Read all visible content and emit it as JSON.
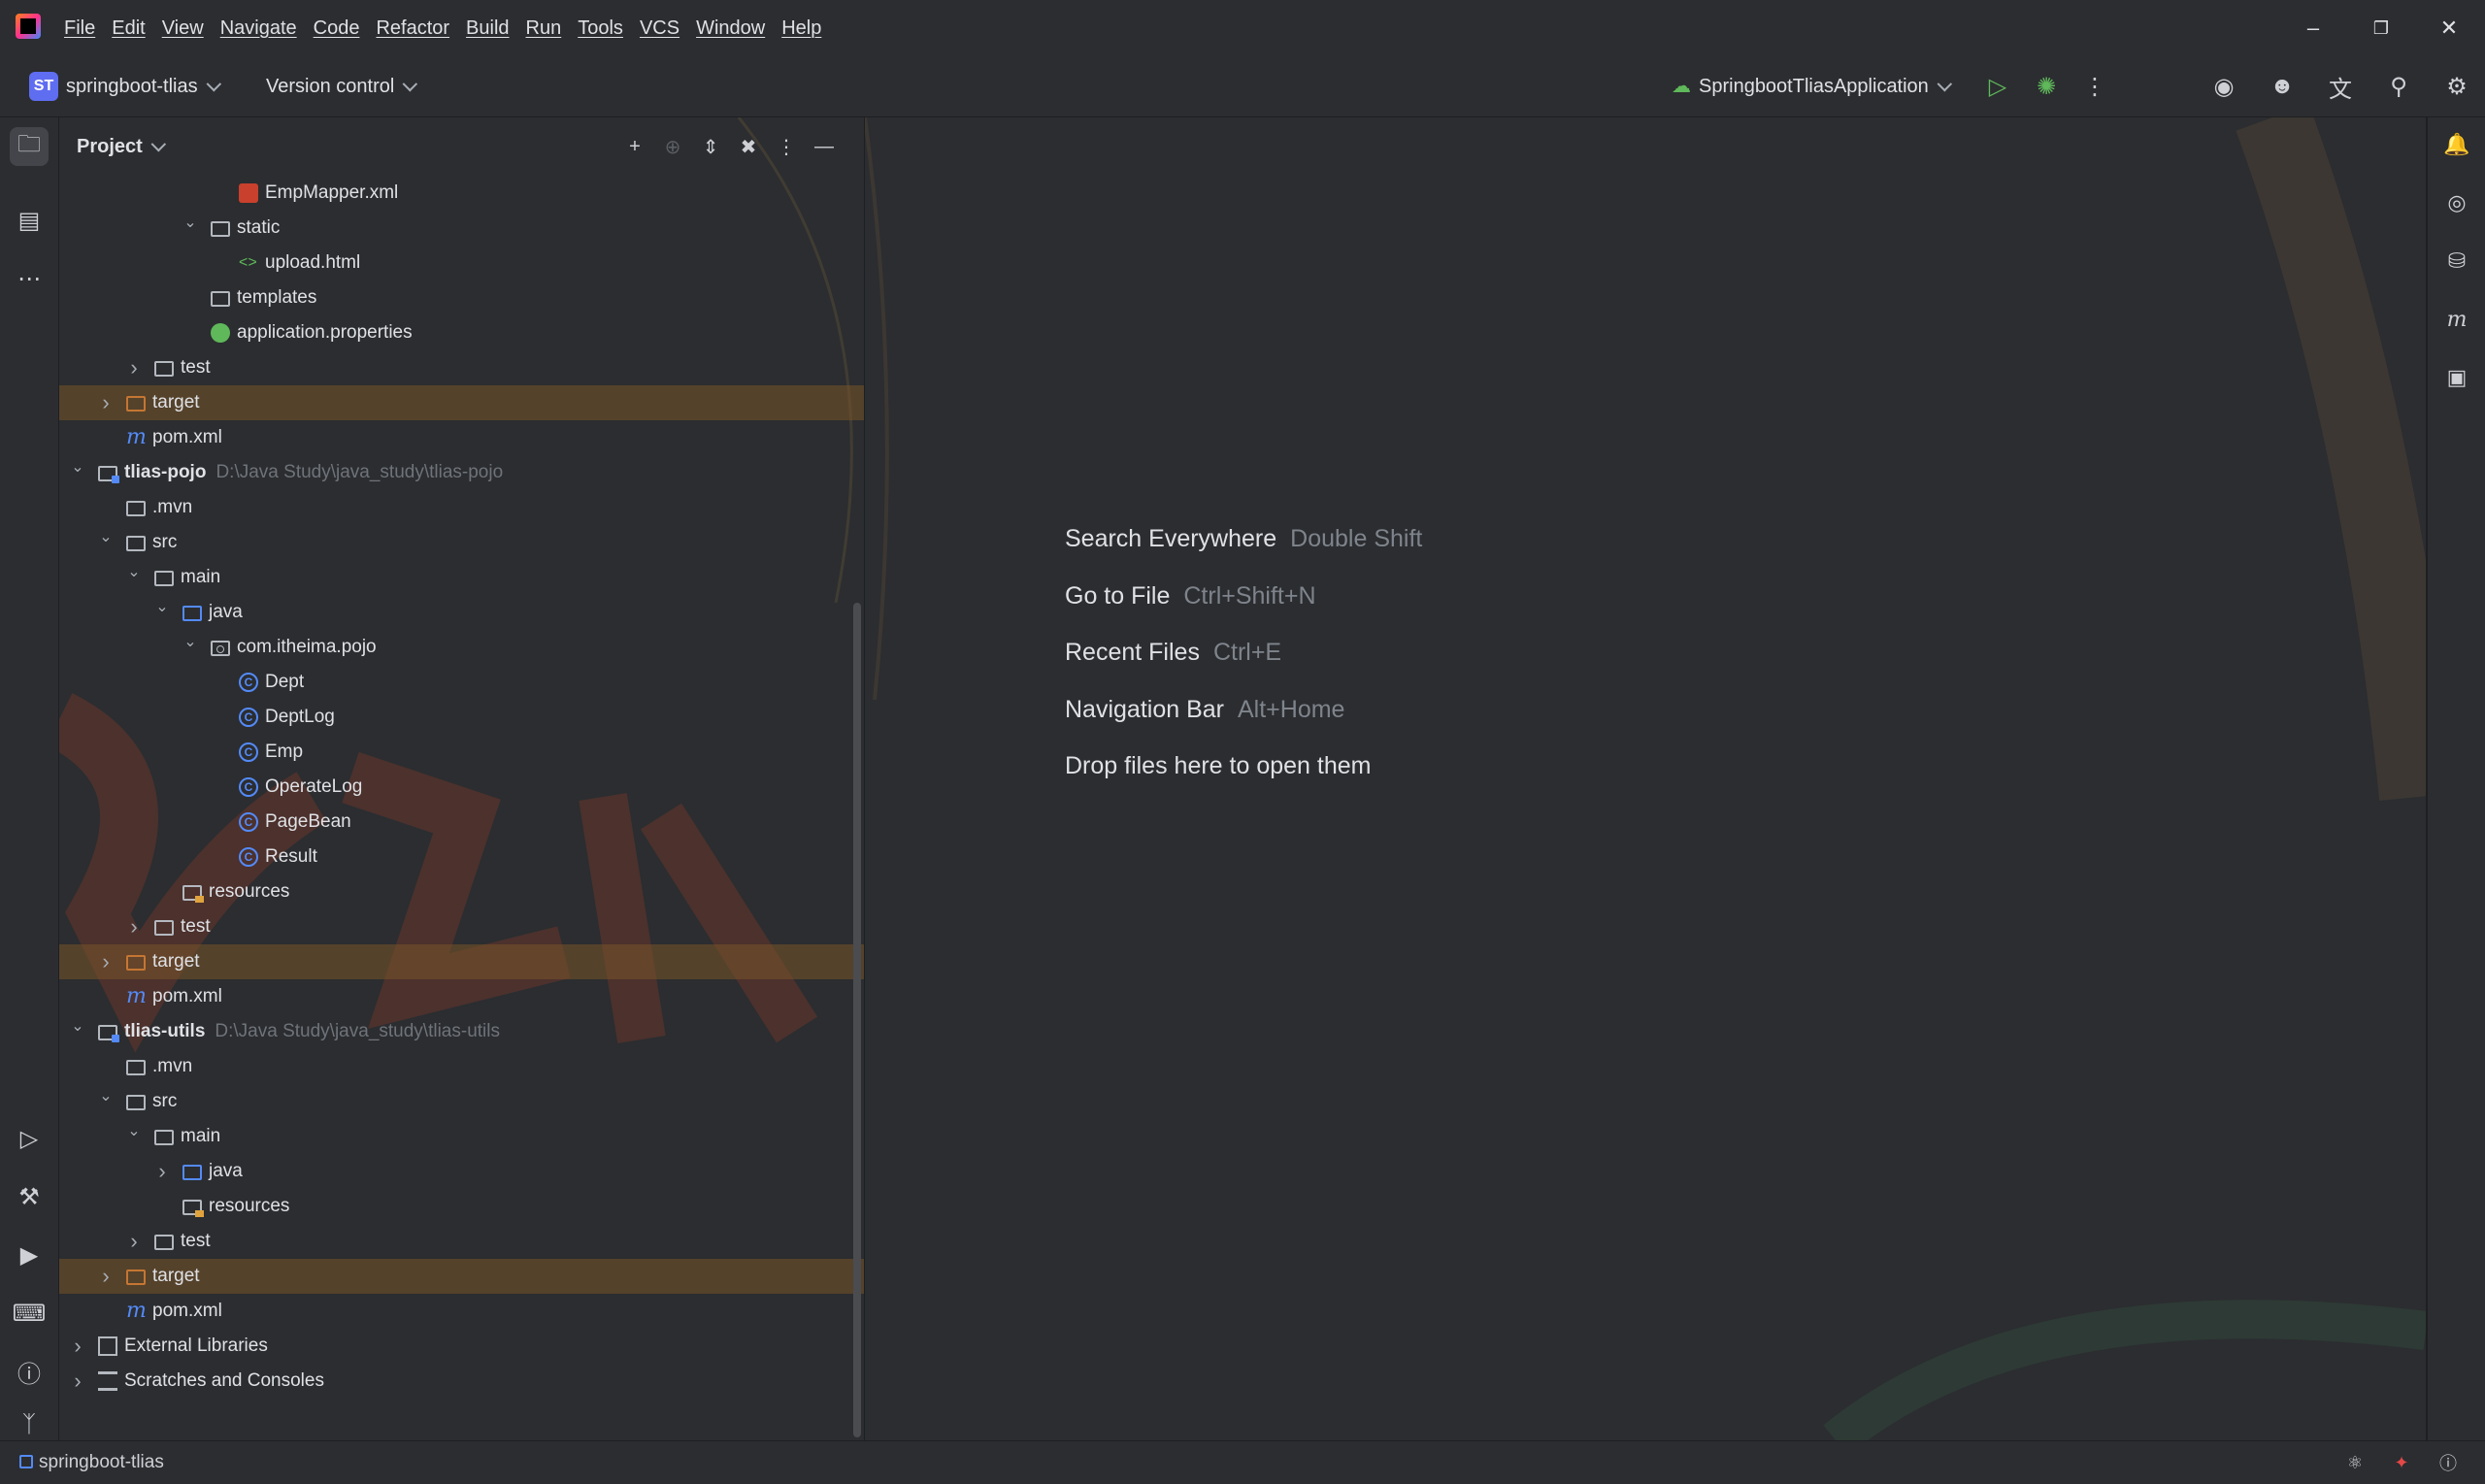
{
  "menu": [
    "File",
    "Edit",
    "View",
    "Navigate",
    "Code",
    "Refactor",
    "Build",
    "Run",
    "Tools",
    "VCS",
    "Window",
    "Help"
  ],
  "toolbar": {
    "project_badge": "ST",
    "project_name": "springboot-tlias",
    "version_control": "Version control",
    "run_config": "SpringbootTliasApplication"
  },
  "panel": {
    "title": "Project"
  },
  "tree": [
    {
      "depth": 6,
      "arrow": "",
      "icon": "xml",
      "label": "EmpMapper.xml",
      "hl": false
    },
    {
      "depth": 5,
      "arrow": "open",
      "icon": "folder",
      "label": "static",
      "hl": false
    },
    {
      "depth": 6,
      "arrow": "",
      "icon": "html",
      "label": "upload.html",
      "hl": false
    },
    {
      "depth": 5,
      "arrow": "",
      "icon": "folder",
      "label": "templates",
      "hl": false
    },
    {
      "depth": 5,
      "arrow": "",
      "icon": "props",
      "label": "application.properties",
      "hl": false
    },
    {
      "depth": 3,
      "arrow": "closed",
      "icon": "folder",
      "label": "test",
      "hl": false
    },
    {
      "depth": 2,
      "arrow": "closed",
      "icon": "folder-target",
      "label": "target",
      "hl": true
    },
    {
      "depth": 2,
      "arrow": "",
      "icon": "maven",
      "label": "pom.xml",
      "hl": false
    },
    {
      "depth": 1,
      "arrow": "open",
      "icon": "folder-module",
      "label": "tlias-pojo",
      "path": "D:\\Java Study\\java_study\\tlias-pojo",
      "bold": true,
      "hl": false
    },
    {
      "depth": 2,
      "arrow": "",
      "icon": "folder",
      "label": ".mvn",
      "hl": false
    },
    {
      "depth": 2,
      "arrow": "open",
      "icon": "folder",
      "label": "src",
      "hl": false
    },
    {
      "depth": 3,
      "arrow": "open",
      "icon": "folder",
      "label": "main",
      "hl": false
    },
    {
      "depth": 4,
      "arrow": "open",
      "icon": "folder-blue",
      "label": "java",
      "hl": false
    },
    {
      "depth": 5,
      "arrow": "open",
      "icon": "folder-package",
      "label": "com.itheima.pojo",
      "hl": false
    },
    {
      "depth": 6,
      "arrow": "",
      "icon": "class",
      "label": "Dept",
      "hl": false
    },
    {
      "depth": 6,
      "arrow": "",
      "icon": "class",
      "label": "DeptLog",
      "hl": false
    },
    {
      "depth": 6,
      "arrow": "",
      "icon": "class",
      "label": "Emp",
      "hl": false
    },
    {
      "depth": 6,
      "arrow": "",
      "icon": "class",
      "label": "OperateLog",
      "hl": false
    },
    {
      "depth": 6,
      "arrow": "",
      "icon": "class",
      "label": "PageBean",
      "hl": false
    },
    {
      "depth": 6,
      "arrow": "",
      "icon": "class",
      "label": "Result",
      "hl": false
    },
    {
      "depth": 4,
      "arrow": "",
      "icon": "folder-resources",
      "label": "resources",
      "hl": false
    },
    {
      "depth": 3,
      "arrow": "closed",
      "icon": "folder",
      "label": "test",
      "hl": false
    },
    {
      "depth": 2,
      "arrow": "closed",
      "icon": "folder-target",
      "label": "target",
      "hl": true
    },
    {
      "depth": 2,
      "arrow": "",
      "icon": "maven",
      "label": "pom.xml",
      "hl": false
    },
    {
      "depth": 1,
      "arrow": "open",
      "icon": "folder-module",
      "label": "tlias-utils",
      "path": "D:\\Java Study\\java_study\\tlias-utils",
      "bold": true,
      "hl": false
    },
    {
      "depth": 2,
      "arrow": "",
      "icon": "folder",
      "label": ".mvn",
      "hl": false
    },
    {
      "depth": 2,
      "arrow": "open",
      "icon": "folder",
      "label": "src",
      "hl": false
    },
    {
      "depth": 3,
      "arrow": "open",
      "icon": "folder",
      "label": "main",
      "hl": false
    },
    {
      "depth": 4,
      "arrow": "closed",
      "icon": "folder-blue",
      "label": "java",
      "hl": false
    },
    {
      "depth": 4,
      "arrow": "",
      "icon": "folder-resources",
      "label": "resources",
      "hl": false
    },
    {
      "depth": 3,
      "arrow": "closed",
      "icon": "folder",
      "label": "test",
      "hl": false
    },
    {
      "depth": 2,
      "arrow": "closed",
      "icon": "folder-target",
      "label": "target",
      "hl": true
    },
    {
      "depth": 2,
      "arrow": "",
      "icon": "maven",
      "label": "pom.xml",
      "hl": false
    },
    {
      "depth": 1,
      "arrow": "closed",
      "icon": "library",
      "label": "External Libraries",
      "hl": false
    },
    {
      "depth": 1,
      "arrow": "closed",
      "icon": "scratches",
      "label": "Scratches and Consoles",
      "hl": false
    }
  ],
  "editor_hints": [
    {
      "action": "Search Everywhere",
      "key": "Double Shift"
    },
    {
      "action": "Go to File",
      "key": "Ctrl+Shift+N"
    },
    {
      "action": "Recent Files",
      "key": "Ctrl+E"
    },
    {
      "action": "Navigation Bar",
      "key": "Alt+Home"
    },
    {
      "action": "Drop files here to open them",
      "key": ""
    }
  ],
  "statusbar": {
    "project": "springboot-tlias"
  },
  "icons": {
    "left_strip": [
      "folder-icon",
      "structure-icon",
      "more-icon",
      "run-icon",
      "build-icon",
      "services-icon",
      "terminal-icon",
      "problems-icon",
      "git-icon"
    ],
    "right_strip": [
      "notifications-icon",
      "ai-assistant-icon",
      "database-icon",
      "maven-icon",
      "translate-doc-icon"
    ]
  },
  "colors": {
    "accent": "#548af7",
    "target_highlight": "#78542a",
    "run_green": "#5fb85a"
  }
}
